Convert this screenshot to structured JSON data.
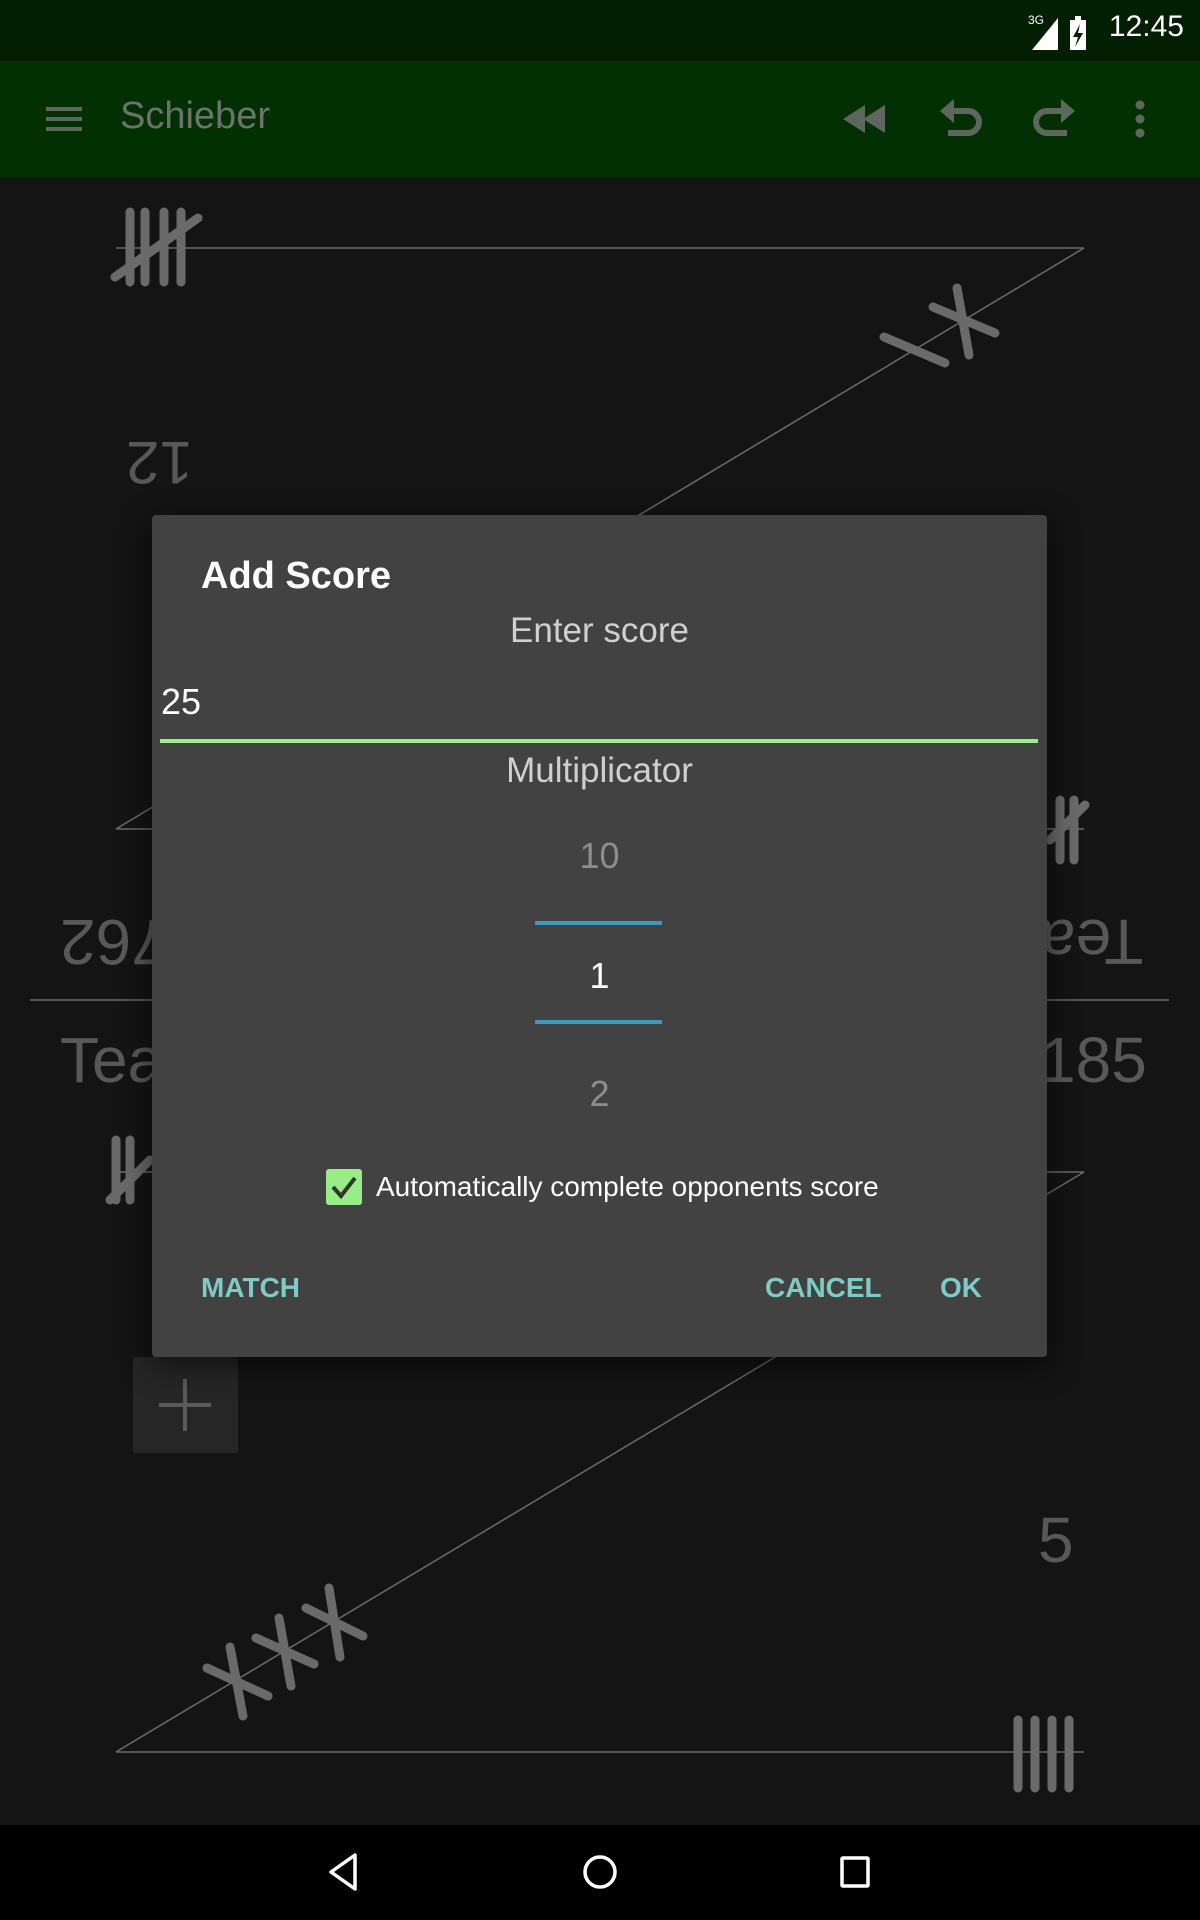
{
  "status_bar": {
    "network": "3G",
    "time": "12:45",
    "icons": [
      "signal-icon",
      "battery-charging-icon"
    ]
  },
  "toolbar": {
    "title": "Schieber",
    "icons": [
      "menu-icon",
      "rewind-icon",
      "undo-icon",
      "redo-icon",
      "more-vert-icon"
    ]
  },
  "board": {
    "top_score": "12",
    "left_upside": "762",
    "right_upside": "Tea",
    "team_bottom": "Tea",
    "score_bottom": "185",
    "bottom_value": "5"
  },
  "dialog": {
    "title": "Add Score",
    "enter_label": "Enter score",
    "score_value": "25",
    "multiplicator_label": "Multiplicator",
    "picker": {
      "prev": "10",
      "selected": "1",
      "next": "2"
    },
    "auto_complete": {
      "label": "Automatically complete opponents score",
      "checked": true
    },
    "buttons": {
      "match": "MATCH",
      "cancel": "CANCEL",
      "ok": "OK"
    },
    "accent": "#7ecdc4",
    "input_accent": "#9cf08a",
    "picker_accent": "#3a9ac0"
  },
  "nav_bar": {
    "icons": [
      "back-icon",
      "home-icon",
      "recents-icon"
    ]
  }
}
